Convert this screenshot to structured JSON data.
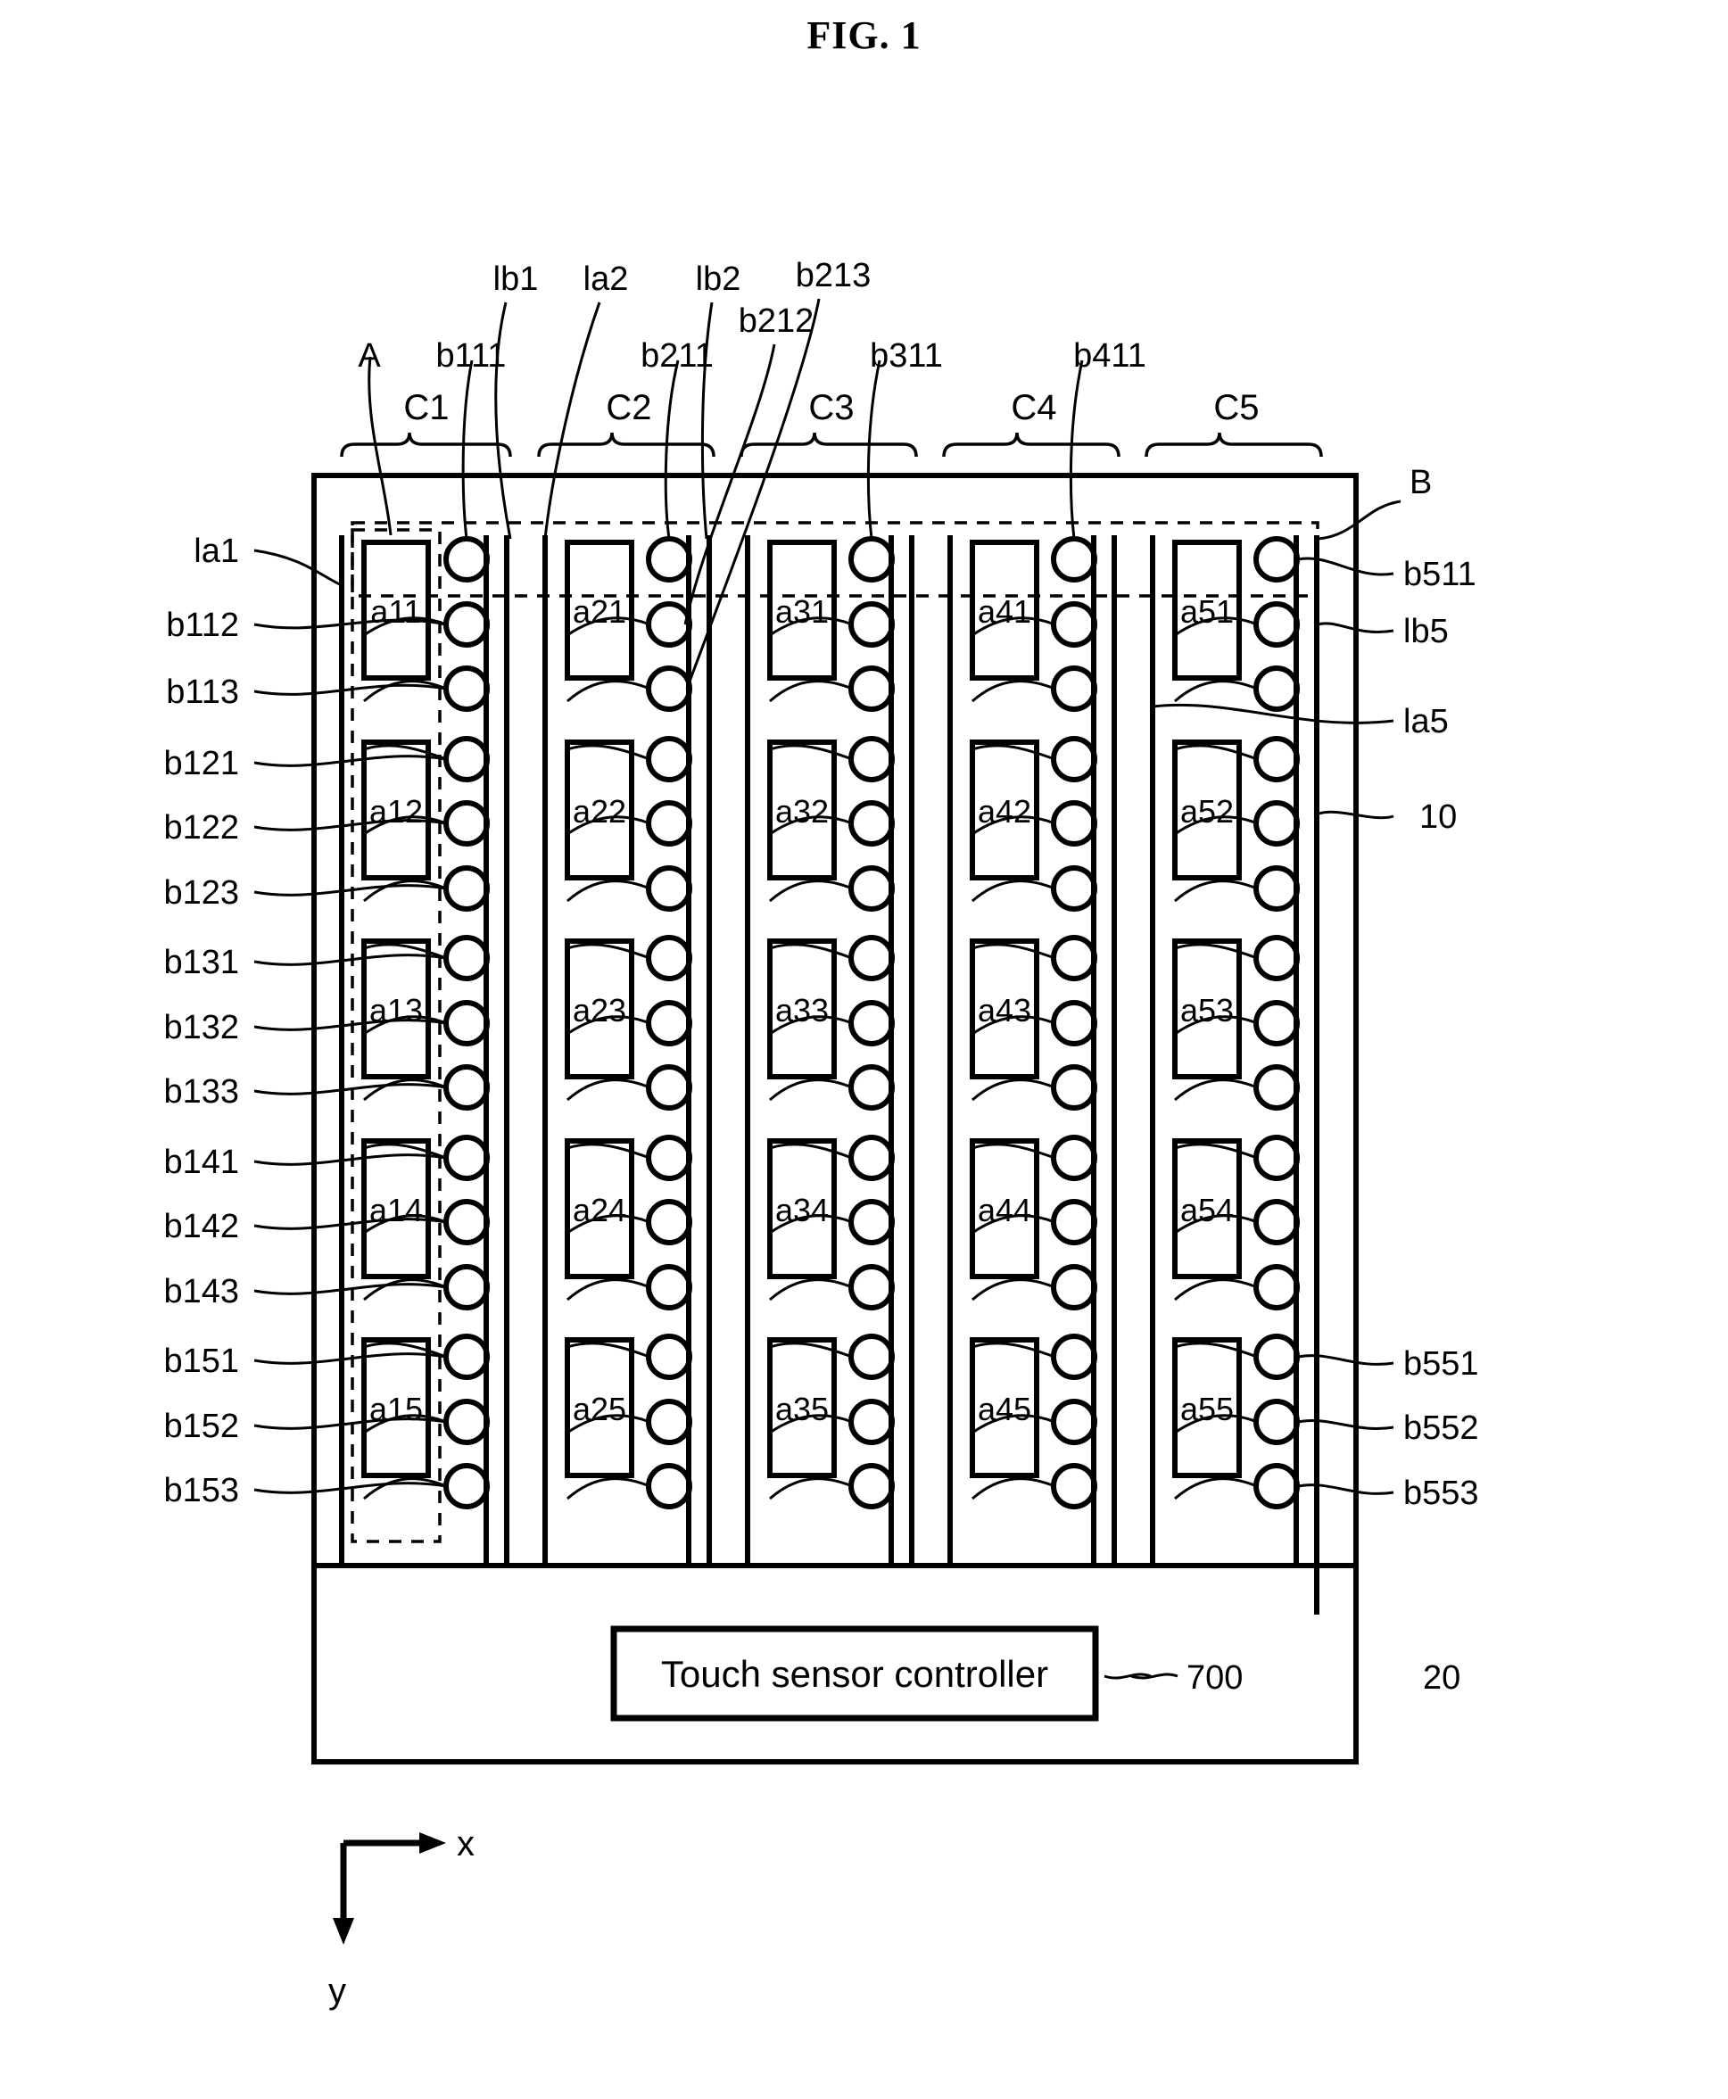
{
  "figure": {
    "title": "FIG. 1",
    "panel_ref": "10",
    "controller_area_ref": "20",
    "controller_label": "Touch sensor controller",
    "controller_ref": "700",
    "region_a_label": "A",
    "region_b_label": "B",
    "axis_x": "x",
    "axis_y": "y"
  },
  "column_brackets": [
    {
      "label": "C1"
    },
    {
      "label": "C2"
    },
    {
      "label": "C3"
    },
    {
      "label": "C4"
    },
    {
      "label": "C5"
    }
  ],
  "top_labels": [
    {
      "text": "A"
    },
    {
      "text": "b111"
    },
    {
      "text": "lb1"
    },
    {
      "text": "la2"
    },
    {
      "text": "b211"
    },
    {
      "text": "lb2"
    },
    {
      "text": "b212"
    },
    {
      "text": "b213"
    },
    {
      "text": "b311"
    },
    {
      "text": "b411"
    }
  ],
  "left_labels": [
    {
      "text": "la1"
    },
    {
      "text": "b112"
    },
    {
      "text": "b113"
    },
    {
      "text": "b121"
    },
    {
      "text": "b122"
    },
    {
      "text": "b123"
    },
    {
      "text": "b131"
    },
    {
      "text": "b132"
    },
    {
      "text": "b133"
    },
    {
      "text": "b141"
    },
    {
      "text": "b142"
    },
    {
      "text": "b143"
    },
    {
      "text": "b151"
    },
    {
      "text": "b152"
    },
    {
      "text": "b153"
    }
  ],
  "right_labels": [
    {
      "text": "B"
    },
    {
      "text": "b511"
    },
    {
      "text": "lb5"
    },
    {
      "text": "la5"
    },
    {
      "text": "10"
    },
    {
      "text": "b551"
    },
    {
      "text": "b552"
    },
    {
      "text": "b553"
    }
  ],
  "sensor_cells": [
    [
      "a11",
      "a12",
      "a13",
      "a14",
      "a15"
    ],
    [
      "a21",
      "a22",
      "a23",
      "a24",
      "a25"
    ],
    [
      "a31",
      "a32",
      "a33",
      "a34",
      "a35"
    ],
    [
      "a41",
      "a42",
      "a43",
      "a44",
      "a45"
    ],
    [
      "a51",
      "a52",
      "a53",
      "a54",
      "a55"
    ]
  ],
  "colors": {
    "stroke": "#000000",
    "background": "#ffffff"
  }
}
